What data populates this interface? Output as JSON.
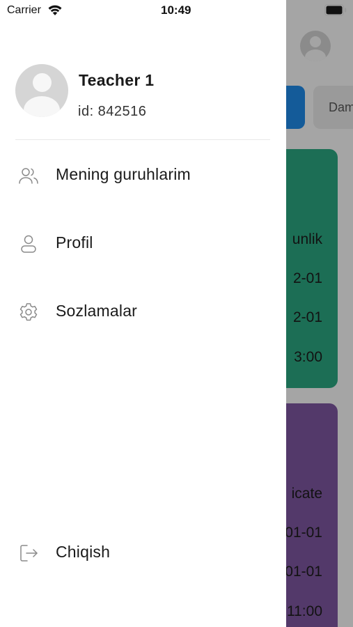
{
  "status_bar": {
    "carrier": "Carrier",
    "time": "10:49",
    "wifi_icon": "wifi-icon",
    "battery_icon": "battery-icon"
  },
  "background": {
    "tab_partial": "Dam",
    "card1": {
      "color": "#2ba57f",
      "lines": [
        "unlik",
        "2-01",
        "2-01",
        "3:00"
      ]
    },
    "card2": {
      "color": "#7d559e",
      "lines": [
        "icate",
        "01-01",
        "01-01",
        "11:00"
      ]
    }
  },
  "drawer": {
    "user": {
      "name": "Teacher 1",
      "id_label": "id: 842516",
      "avatar_icon": "avatar-icon"
    },
    "menu": [
      {
        "label": "Mening guruhlarim",
        "icon": "users-icon"
      },
      {
        "label": "Profil",
        "icon": "user-icon"
      },
      {
        "label": "Sozlamalar",
        "icon": "gear-icon"
      }
    ],
    "logout": {
      "label": "Chiqish",
      "icon": "logout-icon"
    }
  },
  "colors": {
    "accent_blue": "#1e88e5",
    "icon_gray": "#8a8a8a",
    "text": "#1a1a1a"
  }
}
